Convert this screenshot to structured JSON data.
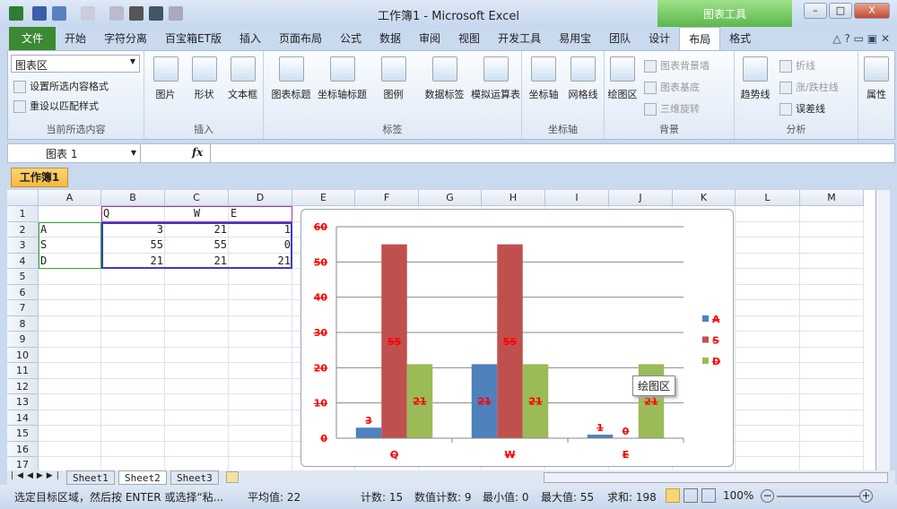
{
  "title": "工作簿1 - Microsoft Excel",
  "chart_tools": "图表工具",
  "window": {
    "minimize": "–",
    "restore": "□",
    "close": "X"
  },
  "tabs": [
    "文件",
    "开始",
    "字符分离",
    "百宝箱ET版",
    "插入",
    "页面布局",
    "公式",
    "数据",
    "审阅",
    "视图",
    "开发工具",
    "易用宝",
    "团队",
    "设计",
    "布局",
    "格式"
  ],
  "active_tab": "布局",
  "ribbon": {
    "selection": {
      "dropdown": "图表区",
      "format": "设置所选内容格式",
      "reset": "重设以匹配样式",
      "label": "当前所选内容"
    },
    "insert": {
      "items": [
        "图片",
        "形状",
        "文本框"
      ],
      "label": "插入"
    },
    "labels": {
      "items": [
        "图表标题",
        "坐标轴标题",
        "图例",
        "数据标签",
        "模拟运算表"
      ],
      "label": "标签"
    },
    "axes": {
      "items": [
        "坐标轴",
        "网格线"
      ],
      "label": "坐标轴"
    },
    "background": {
      "plot_area": "绘图区",
      "wall": "图表背景墙",
      "floor": "图表基底",
      "rotation": "三维旋转",
      "label": "背景"
    },
    "analysis": {
      "trendline": "趋势线",
      "lines": "折线",
      "updown": "涨/跌柱线",
      "error": "误差线",
      "label": "分析"
    },
    "properties": {
      "label": "属性"
    }
  },
  "formula_bar": {
    "name_box": "图表 1",
    "fx": "fx",
    "value": ""
  },
  "workbook_tab": "工作簿1",
  "columns": [
    "A",
    "B",
    "C",
    "D",
    "E",
    "F",
    "G",
    "H",
    "I",
    "J",
    "K",
    "L",
    "M"
  ],
  "rows": [
    "1",
    "2",
    "3",
    "4",
    "5",
    "6",
    "7",
    "8",
    "9",
    "10",
    "11",
    "12",
    "13",
    "14",
    "15",
    "16",
    "17"
  ],
  "cells": [
    {
      "r": 0,
      "c": 1,
      "v": "Q",
      "align": "left"
    },
    {
      "r": 0,
      "c": 2,
      "v": "W",
      "align": "center"
    },
    {
      "r": 0,
      "c": 3,
      "v": "E",
      "align": "left"
    },
    {
      "r": 1,
      "c": 0,
      "v": "A",
      "align": "left"
    },
    {
      "r": 1,
      "c": 1,
      "v": "3",
      "align": "right"
    },
    {
      "r": 1,
      "c": 2,
      "v": "21",
      "align": "right"
    },
    {
      "r": 1,
      "c": 3,
      "v": "1",
      "align": "right"
    },
    {
      "r": 2,
      "c": 0,
      "v": "S",
      "align": "left"
    },
    {
      "r": 2,
      "c": 1,
      "v": "55",
      "align": "right"
    },
    {
      "r": 2,
      "c": 2,
      "v": "55",
      "align": "right"
    },
    {
      "r": 2,
      "c": 3,
      "v": "0",
      "align": "right"
    },
    {
      "r": 3,
      "c": 0,
      "v": "D",
      "align": "left"
    },
    {
      "r": 3,
      "c": 1,
      "v": "21",
      "align": "right"
    },
    {
      "r": 3,
      "c": 2,
      "v": "21",
      "align": "right"
    },
    {
      "r": 3,
      "c": 3,
      "v": "21",
      "align": "right"
    }
  ],
  "chart_data": {
    "type": "bar",
    "categories": [
      "Q",
      "W",
      "E"
    ],
    "series": [
      {
        "name": "A",
        "values": [
          3,
          21,
          1
        ],
        "color": "#4f81bd"
      },
      {
        "name": "S",
        "values": [
          55,
          55,
          0
        ],
        "color": "#c0504d"
      },
      {
        "name": "D",
        "values": [
          21,
          21,
          21
        ],
        "color": "#9bbb59"
      }
    ],
    "ylim": [
      0,
      60
    ],
    "yticks": [
      "0",
      "10",
      "20",
      "30",
      "40",
      "50",
      "60"
    ],
    "legend": "right",
    "grid": true,
    "label_color": "#ff0000"
  },
  "tooltip": "绘图区",
  "sheets": [
    "Sheet1",
    "Sheet2",
    "Sheet3"
  ],
  "active_sheet": "Sheet2",
  "status": {
    "message": "选定目标区域，然后按 ENTER 或选择“粘...",
    "average": "平均值: 22",
    "count": "计数: 15",
    "numcount": "数值计数: 9",
    "min": "最小值: 0",
    "max": "最大值: 55",
    "sum": "求和: 198",
    "zoom": "100%"
  }
}
